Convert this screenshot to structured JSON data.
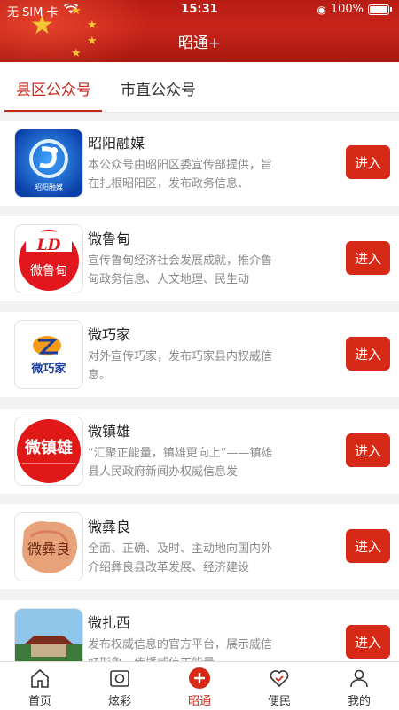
{
  "status": {
    "carrier": "无 SIM 卡",
    "time": "15:31",
    "battery": "100%"
  },
  "header": {
    "title": "昭通+"
  },
  "tabs": [
    {
      "label": "县区公众号",
      "active": true
    },
    {
      "label": "市直公众号",
      "active": false
    }
  ],
  "accounts": [
    {
      "name": "昭阳融媒",
      "desc": "本公众号由昭阳区委宣传部提供，旨在扎根昭阳区，发布政务信息、",
      "button": "进入",
      "logo_text": "昭阳融媒"
    },
    {
      "name": "微鲁甸",
      "desc": "宣传鲁甸经济社会发展成就，推介鲁甸政务信息、人文地理、民生动",
      "button": "进入",
      "logo_text": "微鲁甸"
    },
    {
      "name": "微巧家",
      "desc": "对外宣传巧家，发布巧家县内权威信息。",
      "button": "进入",
      "logo_text": "微巧家"
    },
    {
      "name": "微镇雄",
      "desc": "“汇聚正能量，镇雄更向上”——镇雄县人民政府新闻办权威信息发",
      "button": "进入",
      "logo_text": "微镇雄"
    },
    {
      "name": "微彝良",
      "desc": "全面、正确、及时、主动地向国内外介绍彝良县改革发展、经济建设",
      "button": "进入",
      "logo_text": "微彝良"
    },
    {
      "name": "微扎西",
      "desc": "发布权威信息的官方平台，展示威信好形象，传播威信正能量",
      "button": "进入"
    }
  ],
  "nav": [
    {
      "label": "首页",
      "icon": "home-icon"
    },
    {
      "label": "炫彩",
      "icon": "camera-icon"
    },
    {
      "label": "昭通",
      "icon": "plus-circle-icon",
      "active": true
    },
    {
      "label": "便民",
      "icon": "heart-check-icon"
    },
    {
      "label": "我的",
      "icon": "person-icon"
    }
  ],
  "colors": {
    "accent": "#c8251a",
    "button": "#d62a17"
  }
}
